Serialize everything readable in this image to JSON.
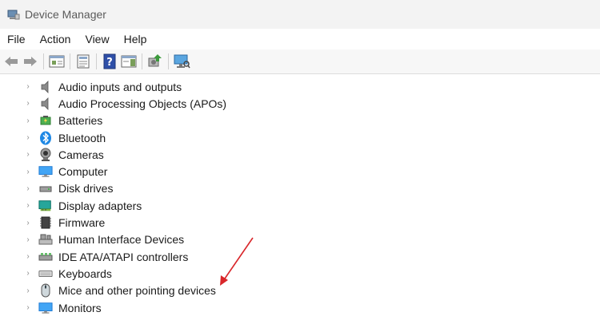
{
  "window": {
    "title": "Device Manager"
  },
  "menu": [
    "File",
    "Action",
    "View",
    "Help"
  ],
  "toolbar": {
    "buttons": [
      "back-arrow-icon",
      "forward-arrow-icon",
      "console-tree-icon",
      "properties-icon",
      "help-icon",
      "action-pane-icon",
      "update-driver-icon",
      "scan-hardware-icon"
    ]
  },
  "device_categories": [
    {
      "label": "Audio inputs and outputs",
      "icon": "speaker-icon"
    },
    {
      "label": "Audio Processing Objects (APOs)",
      "icon": "speaker-icon"
    },
    {
      "label": "Batteries",
      "icon": "battery-icon"
    },
    {
      "label": "Bluetooth",
      "icon": "bluetooth-icon"
    },
    {
      "label": "Cameras",
      "icon": "camera-icon"
    },
    {
      "label": "Computer",
      "icon": "computer-icon"
    },
    {
      "label": "Disk drives",
      "icon": "disk-drive-icon"
    },
    {
      "label": "Display adapters",
      "icon": "display-adapter-icon"
    },
    {
      "label": "Firmware",
      "icon": "firmware-icon"
    },
    {
      "label": "Human Interface Devices",
      "icon": "hid-icon"
    },
    {
      "label": "IDE ATA/ATAPI controllers",
      "icon": "ide-controller-icon"
    },
    {
      "label": "Keyboards",
      "icon": "keyboard-icon"
    },
    {
      "label": "Mice and other pointing devices",
      "icon": "mouse-icon"
    },
    {
      "label": "Monitors",
      "icon": "monitor-icon"
    }
  ],
  "colors": {
    "annotation_arrow": "#d9262a",
    "accent_blue": "#2b7bd6"
  }
}
